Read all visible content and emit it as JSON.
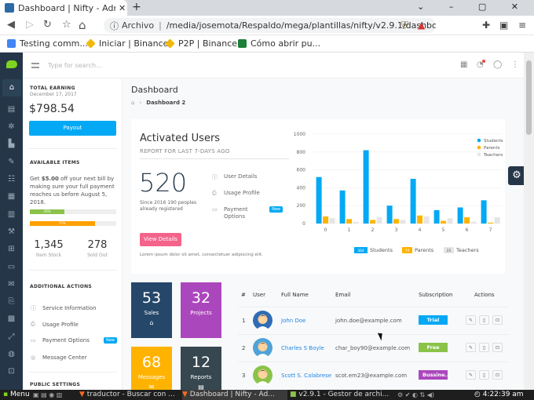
{
  "browser": {
    "tab_title": "Dashboard | Nifty - Admin",
    "tab_close": "✕",
    "new_tab": "+",
    "window_controls": "⌄ – ▢ ✕",
    "security_label": "Archivo",
    "url": "/media/josemota/Respaldo/mega/plantillas/nifty/v2.9.1/dashboard-2....",
    "bookmarks": [
      {
        "label": "Testing comm...",
        "color": "#4285f4"
      },
      {
        "label": "Iniciar | Binance",
        "color": "#f0b90b"
      },
      {
        "label": "P2P | Binance",
        "color": "#f0b90b"
      },
      {
        "label": "Cómo abrir pu...",
        "color": "#1a7f37"
      }
    ]
  },
  "topbar": {
    "search_placeholder": "Type for search..."
  },
  "sidebar": {
    "earning_heading": "TOTAL EARNING",
    "earning_date": "December 17, 2017",
    "earning_value": "$798.54",
    "payout_label": "Payout",
    "available_heading": "AVAILABLE ITEMS",
    "bill_prefix": "Get ",
    "bill_amount": "$5.00",
    "bill_suffix": " off your next bill by making sure your full payment reaches us before August 5, 2018.",
    "progress": [
      {
        "label": "40%",
        "value": 40,
        "color": "#8bc34a"
      },
      {
        "label": "75%",
        "value": 75,
        "color": "#ffa000"
      }
    ],
    "item_stock_value": "1,345",
    "item_stock_label": "Item Stock",
    "sold_out_value": "278",
    "sold_out_label": "Sold Out",
    "additional_heading": "ADDITIONAL ACTIONS",
    "actions": [
      {
        "label": "Service Information",
        "icon": "info-icon",
        "badge": ""
      },
      {
        "label": "Usage Profile",
        "icon": "printer-icon",
        "badge": ""
      },
      {
        "label": "Payment Options",
        "icon": "card-icon",
        "badge": "New"
      },
      {
        "label": "Message Center",
        "icon": "support-icon",
        "badge": ""
      }
    ],
    "public_heading": "PUBLIC SETTINGS"
  },
  "page": {
    "title": "Dashboard",
    "breadcrumb_current": "Dashboard 2"
  },
  "activated": {
    "title": "Activated Users",
    "subtitle": "REPORT FOR LAST 7-DAYS AGO",
    "value": "520",
    "since": "Since 2016 190 peoples already registered",
    "links": [
      {
        "label": "User Details",
        "icon": "user-icon",
        "badge": ""
      },
      {
        "label": "Usage Profile",
        "icon": "printer-icon",
        "badge": ""
      },
      {
        "label": "Payment Options",
        "icon": "card-icon",
        "badge": "New"
      }
    ],
    "button_label": "View Details",
    "lorem": "Lorem ipsum dolor sit amet, consectetuer adipiscing elit."
  },
  "chart_data": {
    "type": "bar",
    "categories": [
      "0",
      "1",
      "2",
      "3",
      "4",
      "5",
      "6",
      "7"
    ],
    "series": [
      {
        "name": "Students",
        "color": "#03a9f4",
        "values": [
          520,
          370,
          820,
          200,
          500,
          150,
          180,
          260
        ]
      },
      {
        "name": "Parents",
        "color": "#ffb300",
        "values": [
          80,
          50,
          40,
          50,
          90,
          30,
          70,
          10
        ]
      },
      {
        "name": "Teachers",
        "color": "#e5e5e5",
        "values": [
          60,
          20,
          70,
          40,
          80,
          60,
          20,
          70
        ]
      }
    ],
    "yticks": [
      "0",
      "200",
      "400",
      "600",
      "800",
      "1000"
    ],
    "ylim": [
      0,
      1000
    ],
    "legend_position": "top-right",
    "footer_legend": [
      {
        "count": "364",
        "label": "Students",
        "color": "#03a9f4"
      },
      {
        "count": "74",
        "label": "Parents",
        "color": "#ffb300"
      },
      {
        "count": "25",
        "label": "Teachers",
        "color": "#e5e5e5"
      }
    ]
  },
  "tiles": [
    {
      "value": "53",
      "label": "Sales",
      "icon": "bag-icon",
      "color": "#25476a"
    },
    {
      "value": "32",
      "label": "Projects",
      "icon": "code-icon",
      "color": "#ab47bc"
    },
    {
      "value": "68",
      "label": "Messages",
      "icon": "mail-icon",
      "color": "#ffb300"
    },
    {
      "value": "12",
      "label": "Reports",
      "icon": "doc-icon",
      "color": "#37474f"
    }
  ],
  "table": {
    "headers": [
      "#",
      "User",
      "Full Name",
      "Email",
      "Subscription",
      "Actions"
    ],
    "rows": [
      {
        "num": "1",
        "name": "John Doe",
        "email": "john.doe@example.com",
        "plan": "Trial",
        "plan_color": "#03a9f4",
        "avatar_color": "#2f6db5"
      },
      {
        "num": "2",
        "name": "Charles S Boyle",
        "email": "char_boy90@example.com",
        "plan": "Free",
        "plan_color": "#8bc34a",
        "avatar_color": "#4fa3d8"
      },
      {
        "num": "3",
        "name": "Scott S. Calabrese",
        "email": "scot.em23@example.com",
        "plan": "Bussine...",
        "plan_color": "#ab47bc",
        "avatar_color": "#8bc34a"
      }
    ]
  },
  "taskbar": {
    "menu": "Menu",
    "tasks": [
      "traductor - Buscar con ...",
      "Dashboard | Nifty - Ad...",
      "v2.9.1 - Gestor de archi..."
    ],
    "clock": "4:22:39 am"
  }
}
